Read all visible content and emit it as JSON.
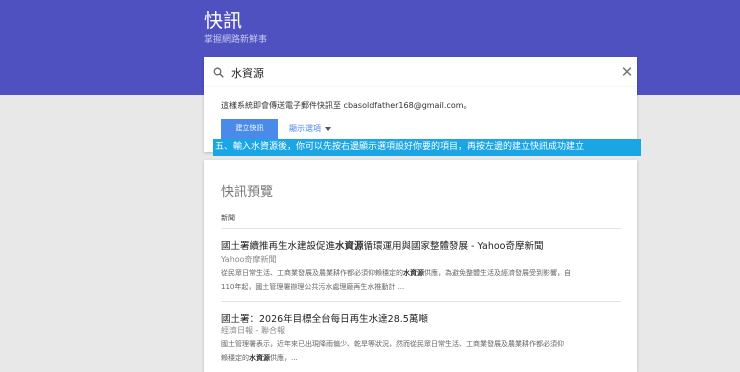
{
  "header": {
    "title": "快訊",
    "subtitle": "掌握網路新鮮事"
  },
  "search": {
    "value": "水資源"
  },
  "options": {
    "notice": "這樣系統即會傳送電子郵件快訊至 cbasoldfather168@gmail.com。",
    "create_label": "建立快訊",
    "show_options_label": "顯示選項"
  },
  "instruction": "五、輸入水資源後，你可以先按右邊顯示選項設好你要的項目，再按左邊的建立快訊成功建立",
  "preview": {
    "title": "快訊預覽",
    "section_label": "新聞",
    "items": [
      {
        "title_pre": "國土署續推再生水建設促進",
        "title_bold": "水資源",
        "title_post": "循環運用與國家整體發展 - Yahoo奇摩新聞",
        "source": "Yahoo奇摩新聞",
        "snippet_line1_pre": "從民眾日常生活、工商業發展及農業耕作都必須仰賴穩定的",
        "snippet_line1_bold": "水資源",
        "snippet_line1_post": "供應，為避免整體生活及經濟發展受到影響，自",
        "snippet_line2": "110年起，國土管理署辦理公共污水處理廠再生水推動計 ..."
      },
      {
        "title_pre": "國土署：2026年目標全台每日再生水達28.5萬噸",
        "source": "經濟日報 - 聯合報",
        "snippet_line1": "國土管理署表示，近年來已出現降雨偏少、乾旱等狀況，然而從民眾日常生活、工商業發展及農業耕作都必須仰",
        "snippet_line2_pre": "賴穩定的",
        "snippet_line2_bold": "水資源",
        "snippet_line2_post": "供應，..."
      }
    ]
  },
  "colors": {
    "header_bg": "#4f51c0",
    "accent": "#4a8ae8",
    "instruction_bg": "#1aa6e4"
  }
}
